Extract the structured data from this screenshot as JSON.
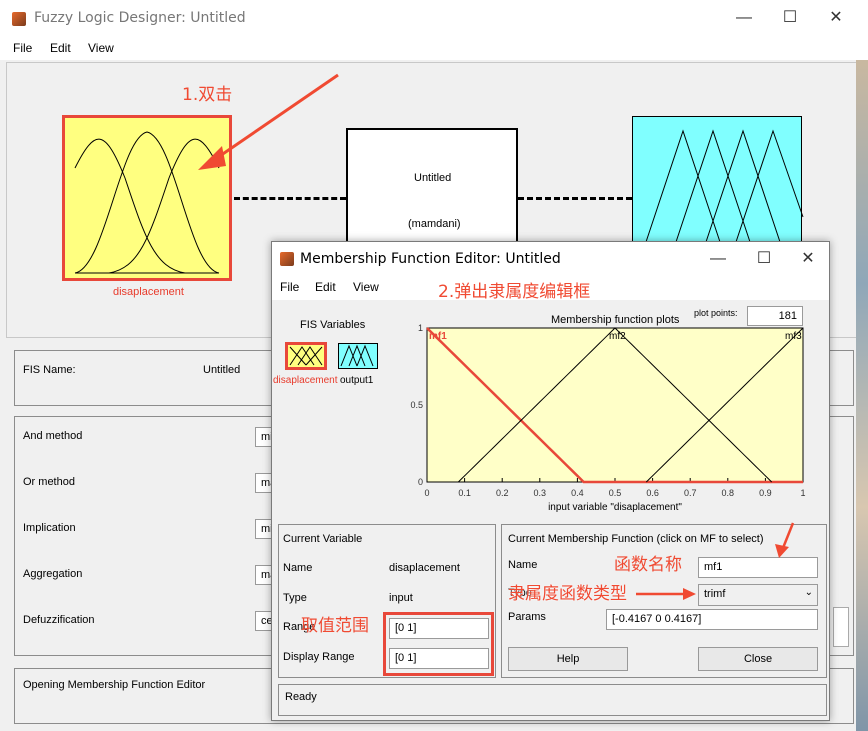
{
  "fuzzy_designer": {
    "title": "Fuzzy Logic Designer: Untitled",
    "menu": [
      "File",
      "Edit",
      "View"
    ],
    "input_label": "disaplacement",
    "system_name": "Untitled",
    "system_type": "(mamdani)",
    "fis_name_label": "FIS Name:",
    "fis_name_value": "Untitled",
    "methods": [
      {
        "label": "And method",
        "value": "mi"
      },
      {
        "label": "Or method",
        "value": "ma"
      },
      {
        "label": "Implication",
        "value": "mi"
      },
      {
        "label": "Aggregation",
        "value": "ma"
      },
      {
        "label": "Defuzzification",
        "value": "ce"
      }
    ],
    "status": "Opening Membership Function Editor"
  },
  "mf_editor": {
    "title": "Membership Function Editor: Untitled",
    "menu": [
      "File",
      "Edit",
      "View"
    ],
    "fis_variables_label": "FIS Variables",
    "var_input": "disaplacement",
    "var_output": "output1",
    "plot_title": "Membership function plots",
    "plot_points_label": "plot points:",
    "plot_points_value": "181",
    "current_variable": {
      "heading": "Current Variable",
      "name_label": "Name",
      "name_value": "disaplacement",
      "type_label": "Type",
      "type_value": "input",
      "range_label": "Range",
      "range_value": "[0 1]",
      "display_range_label": "Display Range",
      "display_range_value": "[0 1]"
    },
    "current_mf": {
      "heading": "Current Membership Function (click on MF to select)",
      "name_label": "Name",
      "name_value": "mf1",
      "type_label": "Type",
      "type_value": "trimf",
      "params_label": "Params",
      "params_value": "[-0.4167 0 0.4167]"
    },
    "help_label": "Help",
    "close_label": "Close",
    "status": "Ready"
  },
  "annotations": {
    "double_click": "1.双击",
    "popup": "2.弹出隶属度编辑框",
    "mf_name": "函数名称",
    "mf_type": "隶属度函数类型",
    "range": "取值范围"
  },
  "chart_data": {
    "type": "line",
    "title": "Membership function plots",
    "xlabel": "input variable \"disaplacement\"",
    "ylabel": "",
    "xlim": [
      0,
      1
    ],
    "ylim": [
      0,
      1
    ],
    "xticks": [
      "0",
      "0.1",
      "0.2",
      "0.3",
      "0.4",
      "0.5",
      "0.6",
      "0.7",
      "0.8",
      "0.9",
      "1"
    ],
    "yticks": [
      "0",
      "0.5",
      "1"
    ],
    "series": [
      {
        "name": "mf1",
        "x": [
          -0.4167,
          0,
          0.4167
        ],
        "y": [
          0,
          1,
          0
        ],
        "selected": true
      },
      {
        "name": "mf2",
        "x": [
          0.0833,
          0.5,
          0.9167
        ],
        "y": [
          0,
          1,
          0
        ]
      },
      {
        "name": "mf3",
        "x": [
          0.5833,
          1,
          1.4167
        ],
        "y": [
          0,
          1,
          0
        ]
      }
    ]
  },
  "colors": {
    "accent_red": "#e8483a",
    "input_yellow": "#ffff80",
    "output_cyan": "#80ffff",
    "plot_bg": "#ffffc8"
  }
}
